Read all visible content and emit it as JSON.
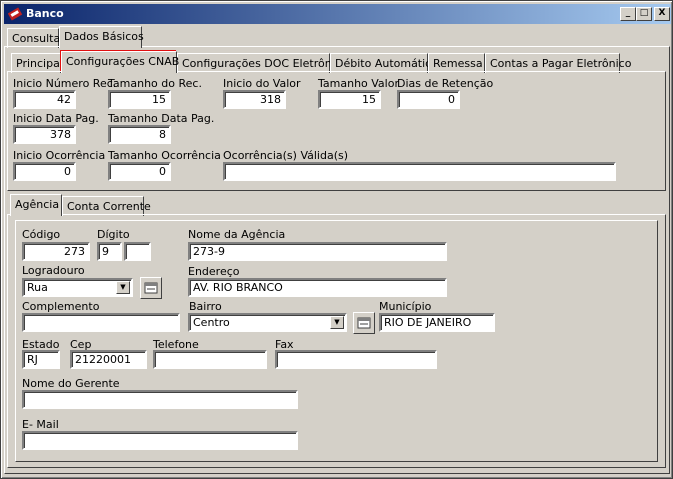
{
  "window": {
    "title": "Banco"
  },
  "title_buttons": {
    "minimize": "_",
    "maximize": "□",
    "close": "X"
  },
  "outer_tabs": [
    "Consulta",
    "Dados Básicos"
  ],
  "inner_tabs": [
    "Principal",
    "Configurações CNAB",
    "Configurações DOC Eletrônico",
    "Débito Automático",
    "Remessa",
    "Contas a Pagar Eletrônico"
  ],
  "cnab": {
    "inicio_numero_rec": {
      "label": "Inicio Número Rec.",
      "value": "42"
    },
    "tamanho_do_rec": {
      "label": "Tamanho do Rec.",
      "value": "15"
    },
    "inicio_do_valor": {
      "label": "Inicio do Valor",
      "value": "318"
    },
    "tamanho_valor": {
      "label": "Tamanho Valor",
      "value": "15"
    },
    "dias_de_retencao": {
      "label": "Dias de Retenção",
      "value": "0"
    },
    "inicio_data_pag": {
      "label": "Inicio Data Pag.",
      "value": "378"
    },
    "tamanho_data_pag": {
      "label": "Tamanho Data Pag.",
      "value": "8"
    },
    "inicio_ocorrencia": {
      "label": "Inicio Ocorrência",
      "value": "0"
    },
    "tamanho_ocorrencia": {
      "label": "Tamanho Ocorrência",
      "value": "0"
    },
    "ocorrencias_validas": {
      "label": "Ocorrência(s) Válida(s)",
      "value": ""
    }
  },
  "lower_tabs": [
    "Agência",
    "Conta Corrente"
  ],
  "agencia": {
    "codigo": {
      "label": "Código",
      "value": "273"
    },
    "digito": {
      "label": "Dígito",
      "value": "9",
      "value2": ""
    },
    "nome_agencia": {
      "label": "Nome da Agência",
      "value": "273-9"
    },
    "logradouro": {
      "label": "Logradouro",
      "value": "Rua"
    },
    "endereco": {
      "label": "Endereço",
      "value": "AV. RIO BRANCO"
    },
    "complemento": {
      "label": "Complemento",
      "value": ""
    },
    "bairro": {
      "label": "Bairro",
      "value": "Centro"
    },
    "municipio": {
      "label": "Município",
      "value": "RIO DE JANEIRO"
    },
    "estado": {
      "label": "Estado",
      "value": "RJ"
    },
    "cep": {
      "label": "Cep",
      "value": "21220001"
    },
    "telefone": {
      "label": "Telefone",
      "value": ""
    },
    "fax": {
      "label": "Fax",
      "value": ""
    },
    "nome_gerente": {
      "label": "Nome do Gerente",
      "value": ""
    },
    "email": {
      "label": "E- Mail",
      "value": ""
    }
  },
  "icons": {
    "app": "bank-icon",
    "lookup": "lookup-icon",
    "dropdown": "chevron-down-icon"
  },
  "colors": {
    "highlight_border": "#e01010",
    "title_start": "#0a246a",
    "title_end": "#a6caf0"
  }
}
